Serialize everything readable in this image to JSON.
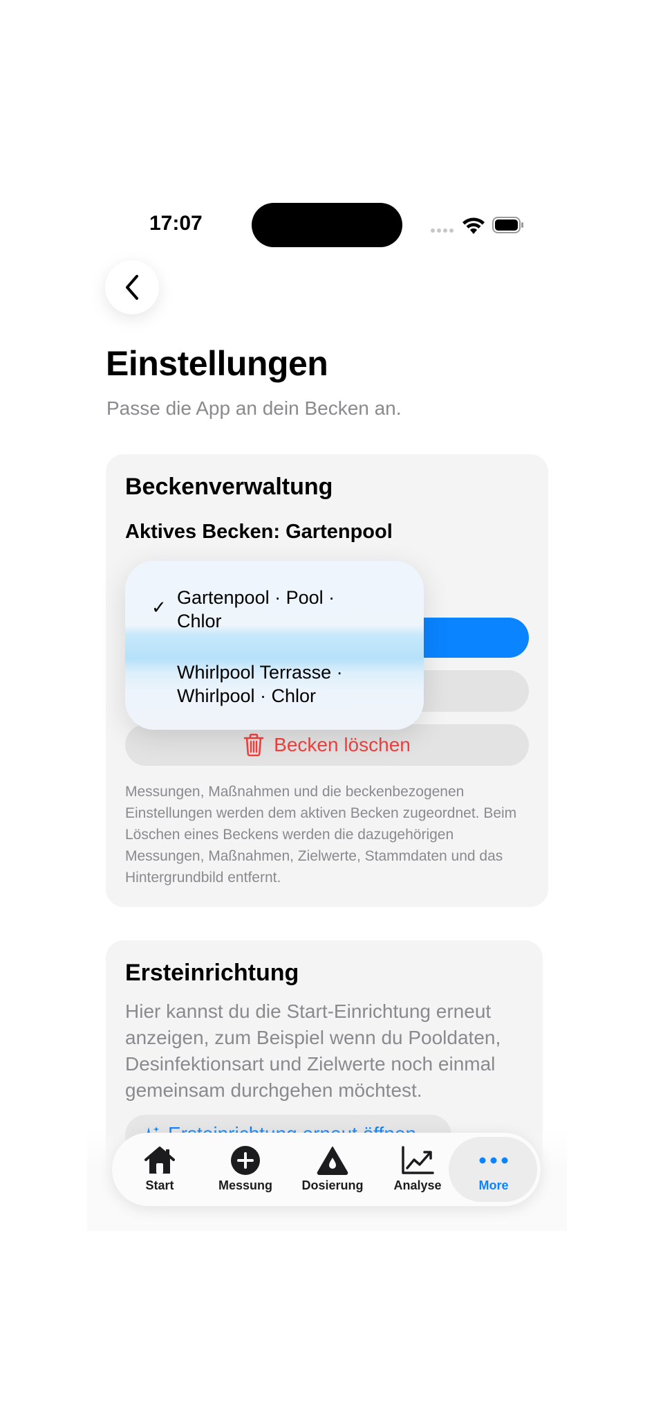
{
  "status_bar": {
    "time": "17:07"
  },
  "header": {
    "title": "Einstellungen",
    "subtitle": "Passe die App an dein Becken an."
  },
  "pool_management": {
    "title": "Beckenverwaltung",
    "active_pool_label": "Aktives Becken: Gartenpool",
    "delete_button": "Becken löschen",
    "note": "Messungen, Maßnahmen und die beckenbezogenen Einstellungen werden dem aktiven Becken zugeordnet. Beim Löschen eines Beckens werden die dazugehörigen Messungen, Maßnahmen, Zielwerte, Stammdaten und das Hintergrundbild entfernt.",
    "menu": {
      "items": [
        {
          "label": "Gartenpool · Pool · Chlor",
          "checked": true,
          "check_mark": "✓"
        },
        {
          "label": "Whirlpool Terrasse · Whirlpool · Chlor",
          "checked": false,
          "check_mark": ""
        }
      ]
    }
  },
  "setup": {
    "title": "Ersteinrichtung",
    "description": "Hier kannst du die Start-Einrichtung erneut anzeigen, zum Beispiel wenn du Pooldaten, Desinfektionsart und Zielwerte noch einmal gemeinsam durchgehen möchtest.",
    "button_label": "Ersteinrichtung erneut öffnen"
  },
  "tab_bar": {
    "items": [
      {
        "label": "Start",
        "icon": "house-icon",
        "active": false
      },
      {
        "label": "Messung",
        "icon": "plus-circle-icon",
        "active": false
      },
      {
        "label": "Dosierung",
        "icon": "drop-icon",
        "active": false
      },
      {
        "label": "Analyse",
        "icon": "chart-line-icon",
        "active": false
      },
      {
        "label": "More",
        "icon": "ellipsis-icon",
        "active": true
      }
    ]
  },
  "colors": {
    "accent": "#0a84ff",
    "destructive": "#f0423f",
    "secondary_text": "#8a8a8e",
    "card_background": "#f4f4f4"
  }
}
